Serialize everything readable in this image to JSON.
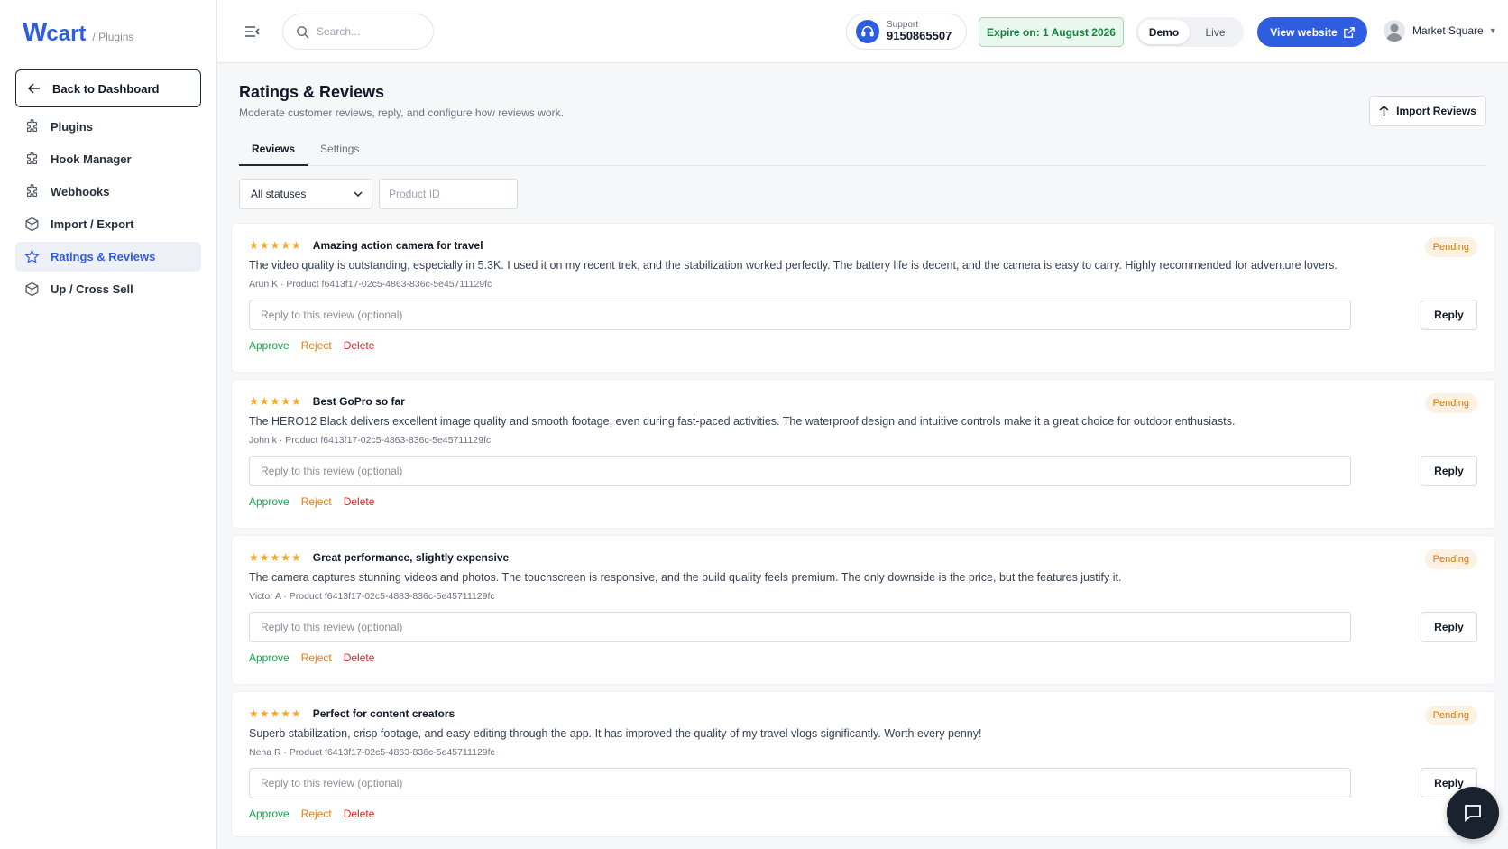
{
  "brand": {
    "logo_w": "W",
    "logo_rest": "cart",
    "section": "/ Plugins"
  },
  "sidebar": {
    "back_label": "Back to Dashboard",
    "items": [
      {
        "label": "Plugins",
        "icon": "puzzle-icon"
      },
      {
        "label": "Hook Manager",
        "icon": "puzzle-icon"
      },
      {
        "label": "Webhooks",
        "icon": "puzzle-icon"
      },
      {
        "label": "Import / Export",
        "icon": "box-icon"
      },
      {
        "label": "Ratings & Reviews",
        "icon": "star-icon",
        "active": true
      },
      {
        "label": "Up / Cross Sell",
        "icon": "box-icon"
      }
    ]
  },
  "topbar": {
    "search_placeholder": "Search...",
    "support_label": "Support",
    "support_phone": "9150865507",
    "expire": "Expire on: 1 August 2026",
    "env_demo": "Demo",
    "env_live": "Live",
    "view_website": "View website",
    "account": "Market Square"
  },
  "page": {
    "title": "Ratings & Reviews",
    "subtitle": "Moderate customer reviews, reply, and configure how reviews work.",
    "import_label": "Import Reviews",
    "tabs": [
      "Reviews",
      "Settings"
    ],
    "status_filter": "All statuses",
    "product_id_placeholder": "Product ID"
  },
  "reviews": [
    {
      "stars": "★★★★★",
      "title": "Amazing action camera for travel",
      "status": "Pending",
      "body": "The video quality is outstanding, especially in 5.3K. I used it on my recent trek, and the stabilization worked perfectly. The battery life is decent, and the camera is easy to carry. Highly recommended for adventure lovers.",
      "meta": "Arun K · Product f6413f17-02c5-4863-836c-5e45711129fc"
    },
    {
      "stars": "★★★★★",
      "title": "Best GoPro so far",
      "status": "Pending",
      "body": "The HERO12 Black delivers excellent image quality and smooth footage, even during fast-paced activities. The waterproof design and intuitive controls make it a great choice for outdoor enthusiasts.",
      "meta": "John k · Product f6413f17-02c5-4863-836c-5e45711129fc"
    },
    {
      "stars": "★★★★★",
      "title": "Great performance, slightly expensive",
      "status": "Pending",
      "body": "The camera captures stunning videos and photos. The touchscreen is responsive, and the build quality feels premium. The only downside is the price, but the features justify it.",
      "meta": "Victor A · Product f6413f17-02c5-4883-836c-5e45711129fc"
    },
    {
      "stars": "★★★★★",
      "title": "Perfect for content creators",
      "status": "Pending",
      "body": "Superb stabilization, crisp footage, and easy editing through the app. It has improved the quality of my travel vlogs significantly. Worth every penny!",
      "meta": "Neha R · Product f6413f17-02c5-4863-836c-5e45711129fc"
    }
  ],
  "review_ui": {
    "reply_placeholder": "Reply to this review (optional)",
    "reply_label": "Reply",
    "approve": "Approve",
    "reject": "Reject",
    "delete": "Delete"
  },
  "colors": {
    "accent": "#2f5de0",
    "pending": "#d97706",
    "approve": "#16a34a",
    "reject": "#ea7a12",
    "delete": "#dc2626"
  }
}
